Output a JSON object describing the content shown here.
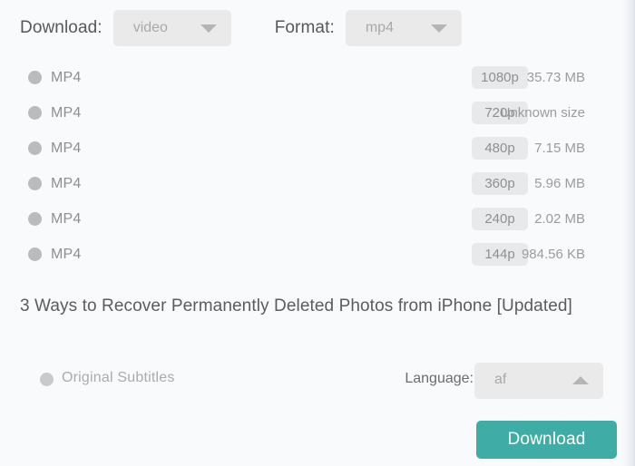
{
  "toolbar": {
    "download_label": "Download:",
    "format_label": "Format:",
    "type_select_value": "video",
    "format_select_value": "mp4",
    "caret_down_icon": "chevron-down-icon"
  },
  "streams": [
    {
      "name": "MP4",
      "quality": "1080p",
      "size": "35.73 MB"
    },
    {
      "name": "MP4",
      "quality": "720p",
      "size": "Unknown size"
    },
    {
      "name": "MP4",
      "quality": "480p",
      "size": "7.15 MB"
    },
    {
      "name": "MP4",
      "quality": "360p",
      "size": "5.96 MB"
    },
    {
      "name": "MP4",
      "quality": "240p",
      "size": "2.02 MB"
    },
    {
      "name": "MP4",
      "quality": "144p",
      "size": "984.56 KB"
    }
  ],
  "video": {
    "title": "3 Ways to Recover Permanently Deleted Photos from iPhone [Updated]"
  },
  "subtitles": {
    "option_label": "Original Subtitles",
    "language_label": "Language:",
    "language_value": "af",
    "caret_up_icon": "chevron-up-icon"
  },
  "actions": {
    "download_button": "Download"
  },
  "colors": {
    "accent": "#3fada5",
    "background": "#f8fafb",
    "control": "#eaeaea",
    "badge": "#e8e9ea",
    "muted_text": "#8d9093"
  }
}
